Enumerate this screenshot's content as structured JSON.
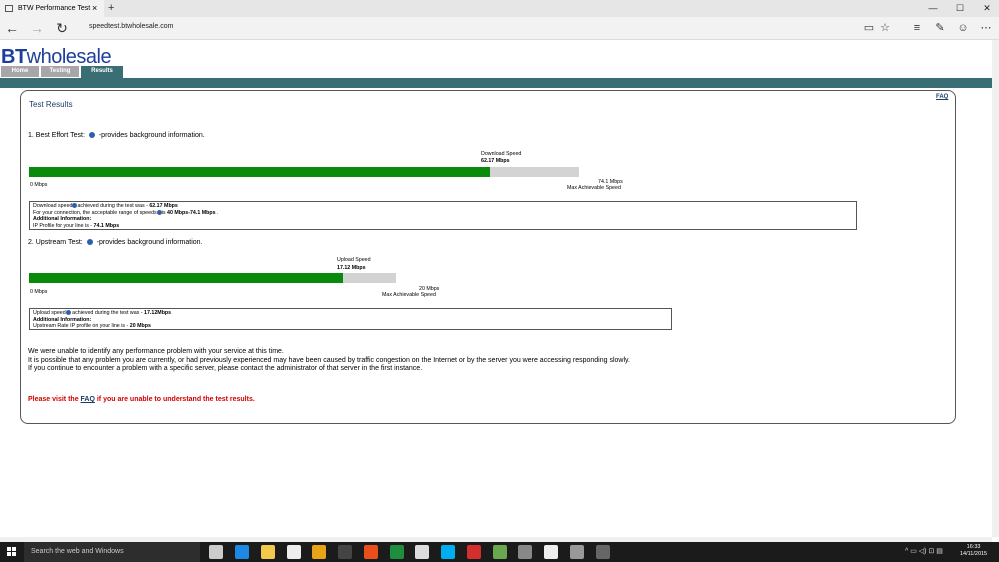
{
  "browser": {
    "tab_title": "BTW Performance Test",
    "tab_close": "×",
    "new_tab": "+",
    "url": "speedtest.btwholesale.com",
    "win_min": "—",
    "win_max": "☐",
    "win_close": "✕",
    "back": "←",
    "forward": "→",
    "refresh": "↻",
    "tools": [
      "▭",
      "☆",
      "≡",
      "✎",
      "☺",
      "⋯"
    ]
  },
  "site": {
    "logo_bt": "BT",
    "logo_rest": "wholesale",
    "nav_tabs": [
      "Home",
      "Testing",
      "Results"
    ],
    "active_tab": "Results",
    "colors": {
      "header": "#3a6e75",
      "tab_inactive": "#a7a7a7",
      "bar": "#0a8a0a",
      "bar_bg": "#d3d3d3",
      "warn": "#d40000"
    }
  },
  "results": {
    "title": "Test Results",
    "faq": "FAQ",
    "download": {
      "heading": "1. Best Effort Test:",
      "heading_suffix": "-provides background information.",
      "gauge_label": "Download Speed",
      "value": "62.17 Mbps",
      "min_label": "0 Mbps",
      "max_label": "74.1 Mbps",
      "max_caption": "Max Achievable Speed",
      "fraction": 0.839,
      "box": {
        "line1_pre": "Download speed",
        "line1_mid": "achieved during the test was - ",
        "line1_val": "62.17 Mbps",
        "line2_pre": "For your connection, the acceptable range of speeds",
        "line2_mid": "is ",
        "line2_val": "40 Mbps-74.1 Mbps",
        "line2_end": " .",
        "line3": "Additional Information:",
        "line4_pre": "IP Profile for your line is - ",
        "line4_val": "74.1 Mbps"
      }
    },
    "upload": {
      "heading": "2. Upstream Test:",
      "heading_suffix": "-provides background information.",
      "gauge_label": "Upload Speed",
      "value": "17.12 Mbps",
      "min_label": "0 Mbps",
      "max_label": "20 Mbps",
      "max_caption": "Max Achievable Speed",
      "fraction": 0.856,
      "box": {
        "line1_pre": "Upload speed",
        "line1_mid": " achieved during the test was - ",
        "line1_val": "17.12Mbps",
        "line3": "Additional Information:",
        "line4_pre": "Upstream Rate IP profile on your line is - ",
        "line4_val": "20 Mbps"
      }
    },
    "messages": [
      "We were unable to identify any performance problem with your service at this time.",
      "It is possible that any problem you are currently, or had previously experienced may have been caused by traffic congestion on the Internet or by the server you were accessing responding slowly.",
      "If you continue to encounter a problem with a specific server, please contact the administrator of that server in the first instance."
    ],
    "cta_pre": "Please visit the ",
    "cta_link": "FAQ",
    "cta_post": " if you are unable to understand the test results."
  },
  "taskbar": {
    "search_placeholder": "Search the web and Windows",
    "time": "16:33",
    "date": "14/11/2015",
    "tray": "^ ▭ ◁) ⊡ ▤",
    "icon_colors": [
      "#cccccc",
      "#1e88e5",
      "#f2c94c",
      "#eeeeee",
      "#e8a317",
      "#444444",
      "#e94e1b",
      "#1e8e3e",
      "#dddddd",
      "#00aff0",
      "#d32f2f",
      "#6aa84f",
      "#888888",
      "#eeeeee",
      "#999999",
      "#666666"
    ]
  }
}
